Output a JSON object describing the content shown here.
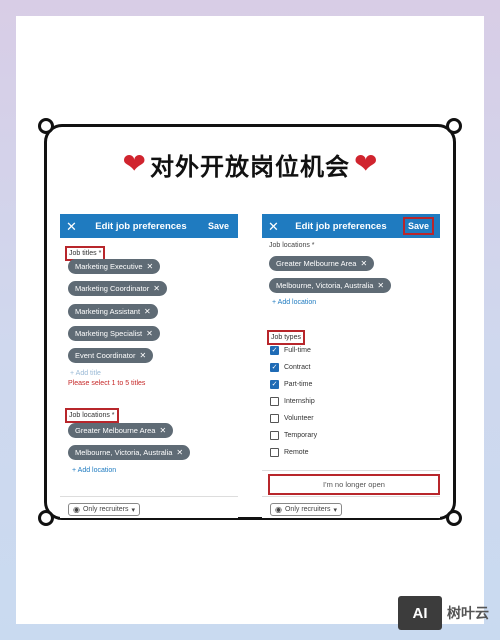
{
  "title": {
    "left_heart": "❤",
    "text": "对外开放岗位机会",
    "right_heart": "❤"
  },
  "left_panel": {
    "header": {
      "close": "✕",
      "title": "Edit job preferences",
      "save": "Save"
    },
    "job_titles_label": "Job titles *",
    "titles": [
      "Marketing Executive",
      "Marketing Coordinator",
      "Marketing Assistant",
      "Marketing Specialist",
      "Event Coordinator"
    ],
    "add_title": "Add title",
    "error": "Please select 1 to 5 titles",
    "job_locations_label": "Job locations *",
    "locations": [
      "Greater Melbourne Area",
      "Melbourne, Victoria, Australia"
    ],
    "add_location": "Add location",
    "visibility": "Only recruiters"
  },
  "right_panel": {
    "header": {
      "close": "✕",
      "title": "Edit job preferences",
      "save": "Save"
    },
    "job_locations_label": "Job locations *",
    "locations": [
      "Greater Melbourne Area",
      "Melbourne, Victoria, Australia"
    ],
    "add_location": "Add location",
    "job_types_label": "Job types",
    "job_types": [
      {
        "label": "Full-time",
        "checked": true
      },
      {
        "label": "Contract",
        "checked": true
      },
      {
        "label": "Part-time",
        "checked": true
      },
      {
        "label": "Internship",
        "checked": false
      },
      {
        "label": "Volunteer",
        "checked": false
      },
      {
        "label": "Temporary",
        "checked": false
      },
      {
        "label": "Remote",
        "checked": false
      }
    ],
    "no_longer_open": "I'm no longer open",
    "visibility": "Only recruiters"
  },
  "watermark": {
    "logo": "AI",
    "name": "树叶云"
  },
  "colors": {
    "accent": "#1f7bc0",
    "highlight": "#b8262b",
    "chip": "#5f6b75"
  },
  "icons": {
    "close": "close-icon",
    "remove": "x-icon",
    "add": "plus-icon",
    "eye": "eye-icon",
    "dropdown": "caret-down-icon",
    "heart": "heart-icon"
  }
}
